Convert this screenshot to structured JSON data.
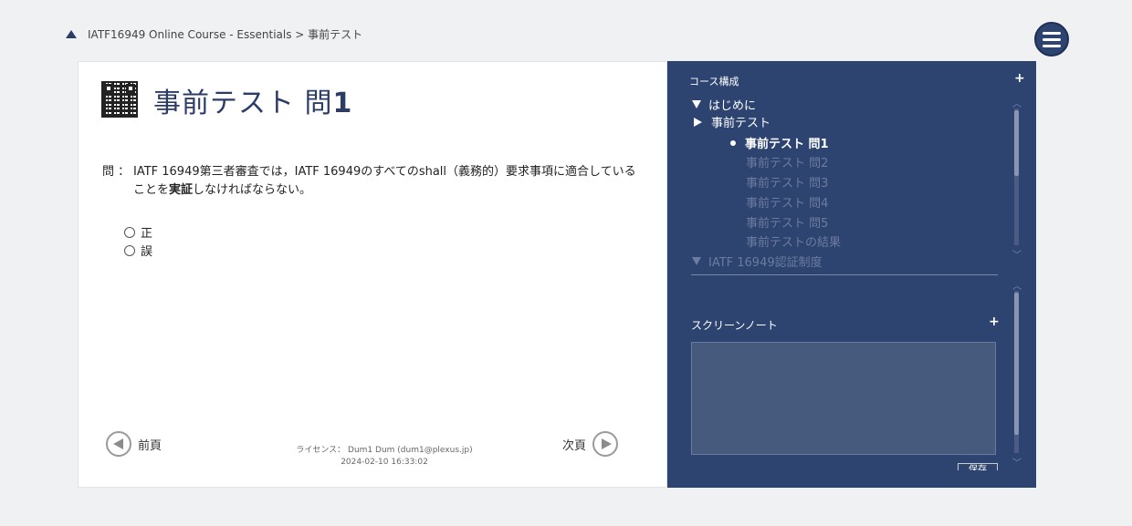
{
  "breadcrumb": {
    "text": "IATF16949 Online Course - Essentials > 事前テスト"
  },
  "page": {
    "title_main": "事前テスト 問",
    "title_num": "1"
  },
  "question": {
    "label": "問 ：",
    "line1": "IATF 16949第三者審査では，IATF 16949のすべてのshall（義務的）要求事項に適合している",
    "line2_pre": "ことを",
    "line2_bold": "実証",
    "line2_post": "しなければならない。",
    "options": [
      "正",
      "誤"
    ]
  },
  "nav": {
    "prev": "前頁",
    "next": "次頁"
  },
  "license": {
    "line1": "ライセンス： Dum1 Dum (dum1@plexus.jp)",
    "line2": "2024-02-10 16:33:02"
  },
  "sidebar": {
    "course_header": "コース構成",
    "plus": "+",
    "tree": {
      "intro": "はじめに",
      "pretest": "事前テスト",
      "items": [
        "事前テスト 問1",
        "事前テスト 問2",
        "事前テスト 問3",
        "事前テスト 問4",
        "事前テスト 問5",
        "事前テストの結果"
      ],
      "next_section": "IATF 16949認証制度"
    },
    "note_header": "スクリーンノート",
    "save_label": "保存"
  },
  "colors": {
    "sidebar": "#2d4370",
    "title": "#2b3c66"
  }
}
